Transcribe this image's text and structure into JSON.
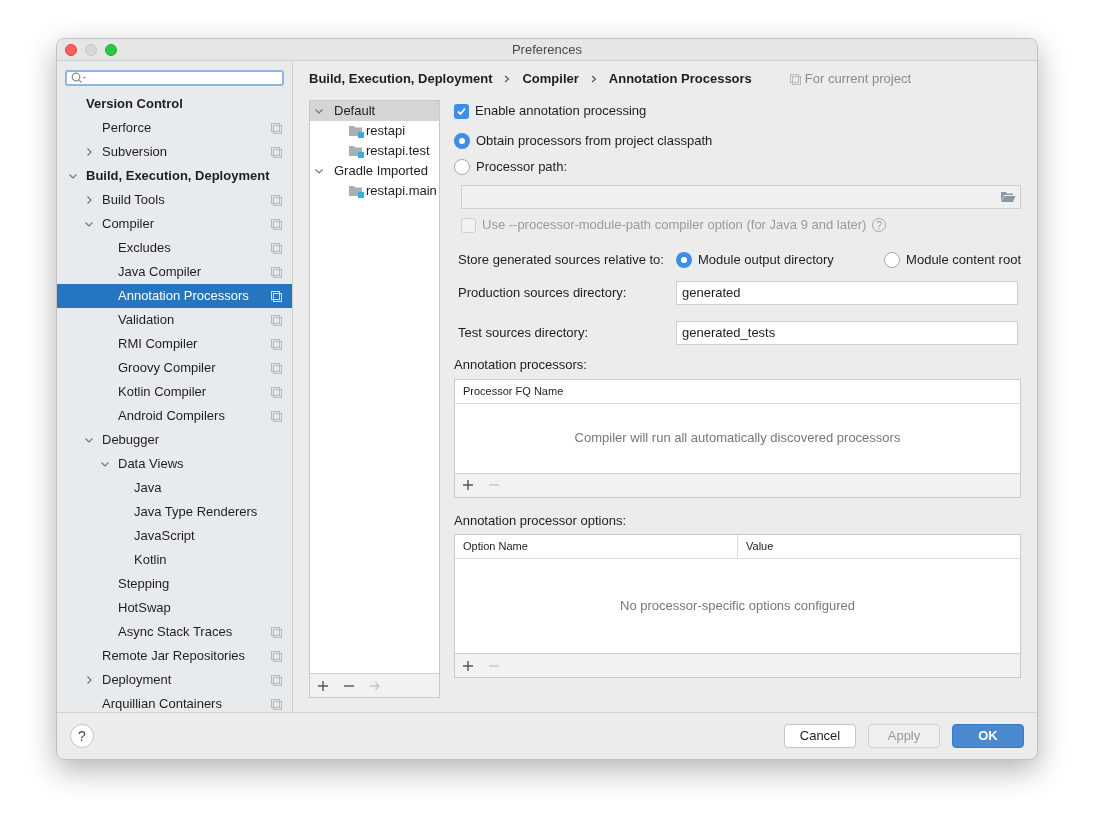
{
  "window": {
    "title": "Preferences"
  },
  "sidebar": {
    "items": [
      {
        "label": "Version Control",
        "bold": true,
        "children": [
          {
            "label": "Perforce",
            "project": true
          },
          {
            "label": "Subversion",
            "expanded": false,
            "project": true
          }
        ]
      },
      {
        "label": "Build, Execution, Deployment",
        "bold": true,
        "expanded": true,
        "children": [
          {
            "label": "Build Tools",
            "expanded": false,
            "project": true
          },
          {
            "label": "Compiler",
            "expanded": true,
            "project": true,
            "children": [
              {
                "label": "Excludes",
                "project": true
              },
              {
                "label": "Java Compiler",
                "project": true
              },
              {
                "label": "Annotation Processors",
                "project": true,
                "selected": true
              },
              {
                "label": "Validation",
                "project": true
              },
              {
                "label": "RMI Compiler",
                "project": true
              },
              {
                "label": "Groovy Compiler",
                "project": true
              },
              {
                "label": "Kotlin Compiler",
                "project": true
              },
              {
                "label": "Android Compilers",
                "project": true
              }
            ]
          },
          {
            "label": "Debugger",
            "expanded": true,
            "children": [
              {
                "label": "Data Views",
                "expanded": true,
                "children": [
                  {
                    "label": "Java"
                  },
                  {
                    "label": "Java Type Renderers"
                  },
                  {
                    "label": "JavaScript"
                  },
                  {
                    "label": "Kotlin"
                  }
                ]
              },
              {
                "label": "Stepping"
              },
              {
                "label": "HotSwap"
              },
              {
                "label": "Async Stack Traces",
                "project": true
              }
            ]
          },
          {
            "label": "Remote Jar Repositories",
            "project": true
          },
          {
            "label": "Deployment",
            "expanded": false,
            "project": true
          },
          {
            "label": "Arquillian Containers",
            "project": true
          }
        ]
      }
    ]
  },
  "breadcrumb": [
    "Build, Execution, Deployment",
    "Compiler",
    "Annotation Processors"
  ],
  "scope_label": "For current project",
  "profiles": {
    "items": [
      {
        "label": "Default",
        "expanded": true,
        "selected": true,
        "children": [
          {
            "label": "restapi",
            "selected": false
          },
          {
            "label": "restapi.test",
            "selected": false
          }
        ]
      },
      {
        "label": "Gradle Imported",
        "expanded": true,
        "selected": false,
        "children": [
          {
            "label": "restapi.main",
            "selected": false
          }
        ]
      }
    ],
    "toolbar": [
      {
        "kind": "add",
        "disabled": false
      },
      {
        "kind": "remove",
        "disabled": false
      },
      {
        "kind": "move",
        "disabled": true
      }
    ]
  },
  "settings": {
    "enable": {
      "label": "Enable annotation processing",
      "checked": true
    },
    "source_options": [
      {
        "label": "Obtain processors from project classpath",
        "selected": true
      },
      {
        "label": "Processor path:",
        "selected": false
      }
    ],
    "processor_path": {
      "disabled": true
    },
    "module_path": {
      "label": "Use --processor-module-path compiler option (for Java 9 and later)",
      "checked": false,
      "disabled": true,
      "help": "?"
    },
    "store": {
      "label": "Store generated sources relative to:",
      "options": [
        {
          "label": "Module output directory",
          "selected": true
        },
        {
          "label": "Module content root",
          "selected": false
        }
      ]
    },
    "fields": [
      {
        "label": "Production sources directory:",
        "value": "generated"
      },
      {
        "label": "Test sources directory:",
        "value": "generated_tests"
      }
    ],
    "processors": {
      "title": "Annotation processors:",
      "columns": [
        "Processor FQ Name"
      ],
      "empty_text": "Compiler will run all automatically discovered processors",
      "toolbar": [
        {
          "kind": "add",
          "disabled": false
        },
        {
          "kind": "remove",
          "disabled": true
        }
      ]
    },
    "options": {
      "title": "Annotation processor options:",
      "columns": [
        "Option Name",
        "Value"
      ],
      "empty_text": "No processor-specific options configured",
      "toolbar": [
        {
          "kind": "add",
          "disabled": false
        },
        {
          "kind": "remove",
          "disabled": true
        }
      ]
    }
  },
  "help_button": "?",
  "buttons": [
    {
      "label": "Cancel",
      "kind": "normal",
      "disabled": false
    },
    {
      "label": "Apply",
      "kind": "normal",
      "disabled": true
    },
    {
      "label": "OK",
      "kind": "default",
      "disabled": false
    }
  ]
}
